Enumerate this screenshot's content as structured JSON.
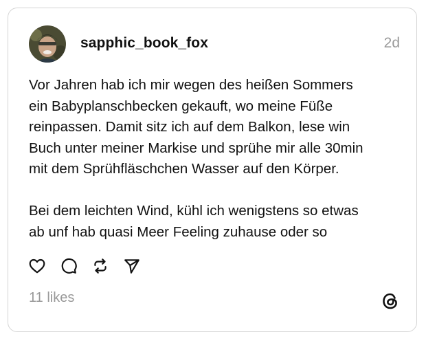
{
  "post": {
    "username": "sapphic_book_fox",
    "timestamp": "2d",
    "paragraphs": [
      "Vor Jahren hab ich mir wegen des heißen Sommers\nein Babyplanschbecken gekauft, wo meine Füße\nreinpassen. Damit sitz ich auf dem Balkon, lese win\nBuch unter meiner Markise und sprühe mir alle 30min\nmit dem Sprühfläschchen Wasser auf den Körper.",
      "Bei dem leichten Wind, kühl ich wenigstens so etwas\nab unf hab quasi Meer Feeling zuhause oder so"
    ],
    "likes": "11 likes"
  },
  "actions": [
    {
      "icon": "heart-icon",
      "label": "like"
    },
    {
      "icon": "comment-icon",
      "label": "reply"
    },
    {
      "icon": "repost-icon",
      "label": "repost"
    },
    {
      "icon": "share-icon",
      "label": "share"
    }
  ],
  "branding": {
    "icon": "threads-logo-icon"
  },
  "colors": {
    "text": "#111111",
    "muted": "#999999",
    "border": "#d4d4d4"
  }
}
